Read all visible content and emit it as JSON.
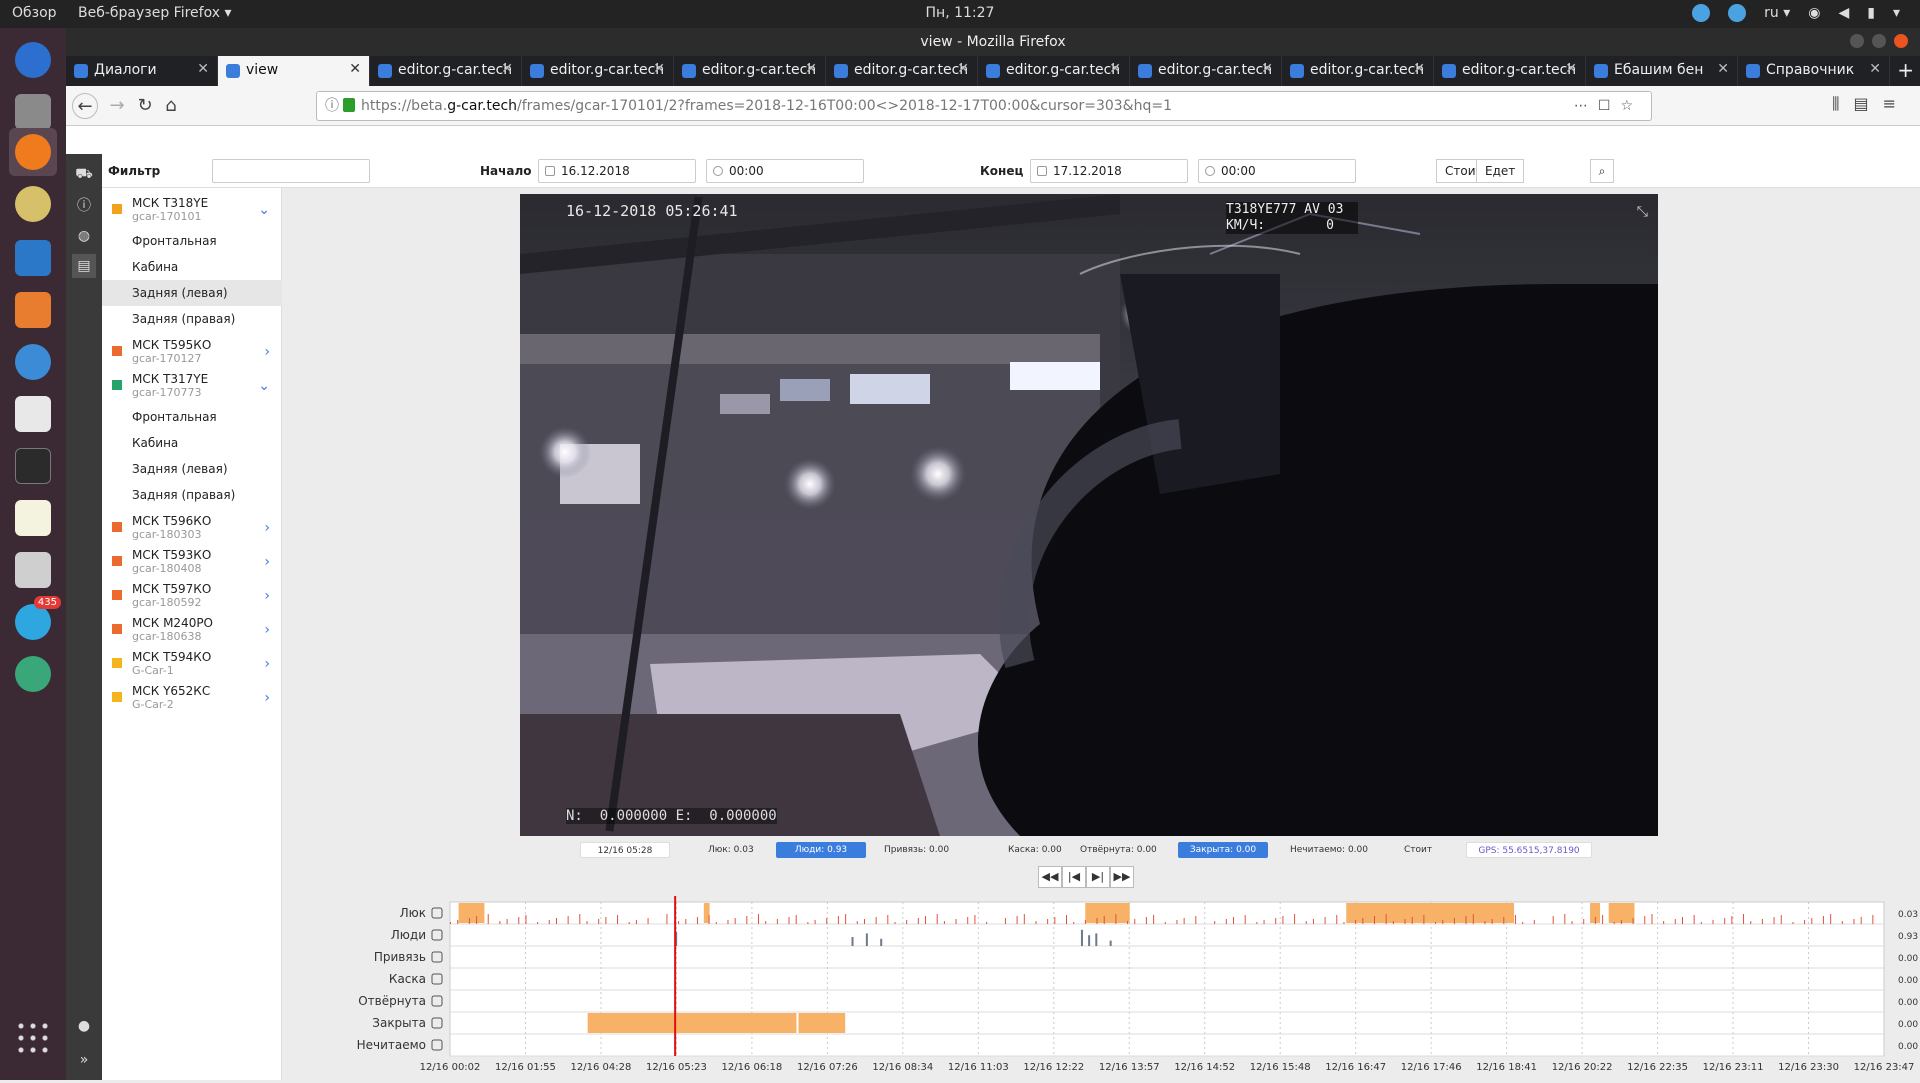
{
  "desktop": {
    "overview": "Обзор",
    "app_name": "Веб-браузер Firefox ▾",
    "clock": "Пн, 11:27",
    "lang": "ru ▾",
    "telegram_badge": "435"
  },
  "window": {
    "title": "view - Mozilla Firefox"
  },
  "tabs": [
    {
      "label": "Диалоги",
      "active": false
    },
    {
      "label": "view",
      "active": true
    },
    {
      "label": "editor.g-car.tech",
      "active": false
    },
    {
      "label": "editor.g-car.tech",
      "active": false
    },
    {
      "label": "editor.g-car.tech",
      "active": false
    },
    {
      "label": "editor.g-car.tech",
      "active": false
    },
    {
      "label": "editor.g-car.tech",
      "active": false
    },
    {
      "label": "editor.g-car.tech",
      "active": false
    },
    {
      "label": "editor.g-car.tech",
      "active": false
    },
    {
      "label": "editor.g-car.tech",
      "active": false
    },
    {
      "label": "Ебашим бен",
      "active": false
    },
    {
      "label": "Справочник",
      "active": false
    }
  ],
  "url": {
    "prefix": "https://beta.",
    "host": "g-car.tech",
    "path": "/frames/gcar-170101/2?frames=2018-12-16T00:00<>2018-12-17T00:00&cursor=303&hq=1"
  },
  "filter": {
    "filter_label": "Фильтр",
    "filter_value": "",
    "start_label": "Начало",
    "start_date": "16.12.2018",
    "start_time": "00:00",
    "end_label": "Конец",
    "end_date": "17.12.2018",
    "end_time": "00:00",
    "btn_stands": "Стоит",
    "btn_moving": "Едет"
  },
  "vehicles": [
    {
      "name": "МСК Т318YE",
      "code": "gcar-170101",
      "color": "#f4a21e",
      "expanded": true,
      "cams": [
        {
          "label": "Фронтальная",
          "sel": false
        },
        {
          "label": "Кабина",
          "sel": false
        },
        {
          "label": "Задняя (левая)",
          "sel": true
        },
        {
          "label": "Задняя (правая)",
          "sel": false
        }
      ]
    },
    {
      "name": "МСК Т595КО",
      "code": "gcar-170127",
      "color": "#ec6a2e",
      "expanded": false,
      "cams": []
    },
    {
      "name": "МСК Т317YE",
      "code": "gcar-170773",
      "color": "#24a36a",
      "expanded": true,
      "cams": [
        {
          "label": "Фронтальная",
          "sel": false
        },
        {
          "label": "Кабина",
          "sel": false
        },
        {
          "label": "Задняя (левая)",
          "sel": false
        },
        {
          "label": "Задняя (правая)",
          "sel": false
        }
      ]
    },
    {
      "name": "МСК Т596КО",
      "code": "gcar-180303",
      "color": "#ec6a2e",
      "expanded": false,
      "cams": []
    },
    {
      "name": "МСК Т593КО",
      "code": "gcar-180408",
      "color": "#ec6a2e",
      "expanded": false,
      "cams": []
    },
    {
      "name": "МСК Т597КО",
      "code": "gcar-180592",
      "color": "#ec6a2e",
      "expanded": false,
      "cams": []
    },
    {
      "name": "МСК М240РО",
      "code": "gcar-180638",
      "color": "#ec6a2e",
      "expanded": false,
      "cams": []
    },
    {
      "name": "МСК Т594КО",
      "code": "G-Car-1",
      "color": "#f4b41e",
      "expanded": false,
      "cams": []
    },
    {
      "name": "МСК Y652КС",
      "code": "G-Car-2",
      "color": "#f4b41e",
      "expanded": false,
      "cams": []
    }
  ],
  "video": {
    "timestamp": "16-12-2018 05:26:41",
    "plate": "T318YE777 AV 03",
    "speed_label": "КМ/Ч:",
    "speed_value": "0",
    "coords": "N:  0.000000 E:  0.000000"
  },
  "status": [
    {
      "text": "12/16 05:28",
      "hl": false
    },
    {
      "text": "Люк: 0.03",
      "hl": false
    },
    {
      "text": "Люди: 0.93",
      "hl": true
    },
    {
      "text": "Привязь: 0.00",
      "hl": false
    },
    {
      "text": "Каска: 0.00",
      "hl": false
    },
    {
      "text": "Отвёрнута: 0.00",
      "hl": false
    },
    {
      "text": "Закрыта: 0.00",
      "hl": true
    },
    {
      "text": "Нечитаемо: 0.00",
      "hl": false
    },
    {
      "text": "Стоит",
      "hl": false
    },
    {
      "text": "GPS: 55.6515,37.8190",
      "hl": false
    }
  ],
  "controls": {
    "rewind": "◀◀",
    "step_back": "|◀",
    "step_fwd": "▶|",
    "fwd": "▶▶"
  },
  "timeline": {
    "rows": [
      {
        "label": "Люк",
        "value": "0.03",
        "icon": "hatch-icon"
      },
      {
        "label": "Люди",
        "value": "0.93",
        "icon": "person-icon"
      },
      {
        "label": "Привязь",
        "value": "0.00",
        "icon": "harness-icon"
      },
      {
        "label": "Каска",
        "value": "0.00",
        "icon": "helmet-icon"
      },
      {
        "label": "Отвёрнута",
        "value": "0.00",
        "icon": "turned-away-icon"
      },
      {
        "label": "Закрыта",
        "value": "0.00",
        "icon": "covered-icon"
      },
      {
        "label": "Нечитаемо",
        "value": "0.00",
        "icon": "trash-icon"
      }
    ],
    "ticks": [
      "12/16 00:02",
      "12/16 01:55",
      "12/16 04:28",
      "12/16 05:23",
      "12/16 06:18",
      "12/16 07:26",
      "12/16 08:34",
      "12/16 11:03",
      "12/16 12:22",
      "12/16 13:57",
      "12/16 14:52",
      "12/16 15:48",
      "12/16 16:47",
      "12/16 17:46",
      "12/16 18:41",
      "12/16 20:22",
      "12/16 22:35",
      "12/16 23:11",
      "12/16 23:30",
      "12/16 23:47"
    ],
    "cursor_fraction": 0.157,
    "hatch_spans": [
      [
        0.006,
        0.024
      ],
      [
        0.177,
        0.181
      ],
      [
        0.443,
        0.474
      ],
      [
        0.625,
        0.72
      ],
      [
        0.72,
        0.742
      ],
      [
        0.795,
        0.802
      ],
      [
        0.808,
        0.826
      ]
    ],
    "covered_spans": [
      [
        0.096,
        0.243
      ],
      [
        0.243,
        0.277
      ]
    ],
    "coverage_spans": [
      [
        0.0,
        0.025
      ],
      [
        0.09,
        0.243
      ],
      [
        0.247,
        0.31
      ],
      [
        0.365,
        0.415
      ],
      [
        0.43,
        0.72
      ],
      [
        0.722,
        0.745
      ],
      [
        0.795,
        0.803
      ],
      [
        0.806,
        1.0
      ]
    ],
    "people_spikes": [
      [
        0.157,
        0.8
      ],
      [
        0.28,
        0.5
      ],
      [
        0.29,
        0.7
      ],
      [
        0.3,
        0.4
      ],
      [
        0.44,
        0.9
      ],
      [
        0.445,
        0.6
      ],
      [
        0.45,
        0.7
      ],
      [
        0.46,
        0.3
      ]
    ]
  }
}
